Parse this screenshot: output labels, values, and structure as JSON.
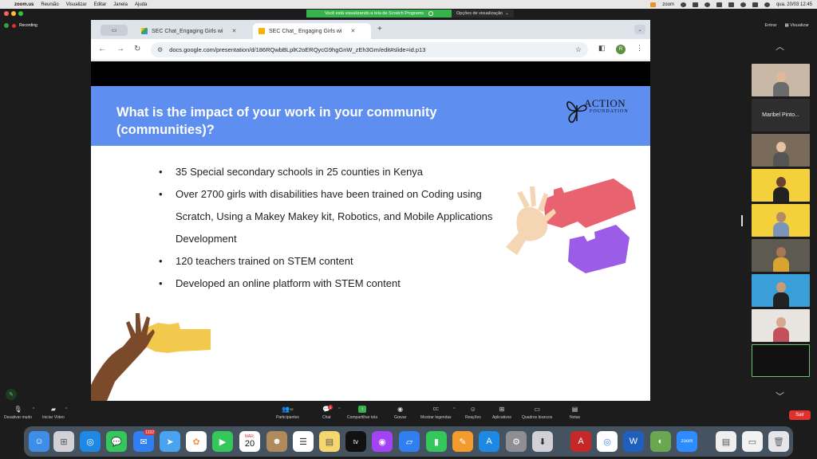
{
  "menubar": {
    "app": "zoom.us",
    "items": [
      "Reunião",
      "Visualizar",
      "Editar",
      "Janela",
      "Ajuda"
    ],
    "right_app": "zoom",
    "datetime": "qua. 20/03  12:45"
  },
  "share_banner": {
    "message": "Você está visualizando a tela de Scratch Programs",
    "options": "Opções de visualização"
  },
  "zoom_top": {
    "recording": "Recording",
    "enter": "Entrar",
    "view": "Visualizar"
  },
  "browser": {
    "tabs": [
      {
        "label": "SEC Chat_Engaging Girls wi",
        "icon": "google-drive-icon",
        "active": false
      },
      {
        "label": "SEC Chat_ Engaging Girls wi",
        "icon": "google-slides-icon",
        "active": true
      }
    ],
    "url": "docs.google.com/presentation/d/186RQwbBLplK2oERQycG9hgGnW_zEh3Gm/edit#slide=id.p13",
    "profile_initial": "R"
  },
  "slide": {
    "title": "What is the impact of your work in your community (communities)?",
    "logo_line1": "ACTION",
    "logo_line2": "FOUNDATION",
    "bullets": [
      "35 Special secondary schools in 25 counties in Kenya",
      "Over 2700 girls with disabilities have been trained on Coding using Scratch, Using a Makey Makey kit, Robotics, and Mobile Applications Development",
      "120 teachers trained on STEM content",
      "Developed an online platform with STEM content"
    ],
    "colors": {
      "header": "#5e8ff0",
      "pink_piece": "#e8626f",
      "purple_piece": "#9b5ce8",
      "yellow_piece": "#f2c94c"
    }
  },
  "participants": {
    "name_tile": "Maribel Pinto..."
  },
  "zoom_toolbar": {
    "mute": "Desativar mudo",
    "video": "Iniciar Vídeo",
    "participants": "Participantes",
    "participants_count": "92",
    "chat": "Chat",
    "chat_badge": "3",
    "share": "Compartilhar tela",
    "record": "Gravar",
    "captions": "Mostrar legendas",
    "reactions": "Reações",
    "apps": "Aplicativos",
    "whiteboards": "Quadros brancos",
    "notes": "Notas",
    "leave": "Sair"
  },
  "dock": {
    "mail_badge": "1332",
    "calendar_month": "MAR.",
    "calendar_day": "20",
    "apple_tv": "tv"
  }
}
